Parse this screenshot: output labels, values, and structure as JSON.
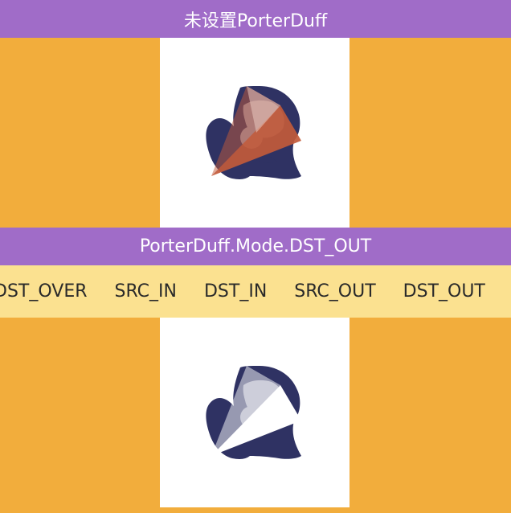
{
  "header": {
    "title": "未设置PorterDuff"
  },
  "mode_header": {
    "title": "PorterDuff.Mode.DST_OUT"
  },
  "mode_selector": {
    "selected": "DST_OUT",
    "items": [
      {
        "label": "DST_OVER"
      },
      {
        "label": "SRC_IN"
      },
      {
        "label": "DST_IN"
      },
      {
        "label": "SRC_OUT"
      },
      {
        "label": "DST_OUT"
      }
    ]
  },
  "colors": {
    "background": "#f2ad3c",
    "title_bar": "#a06cc8",
    "mode_strip": "#fbe190",
    "canvas": "#ffffff",
    "dst_shape": "#2f3263",
    "src_shape": "#b8472a"
  }
}
